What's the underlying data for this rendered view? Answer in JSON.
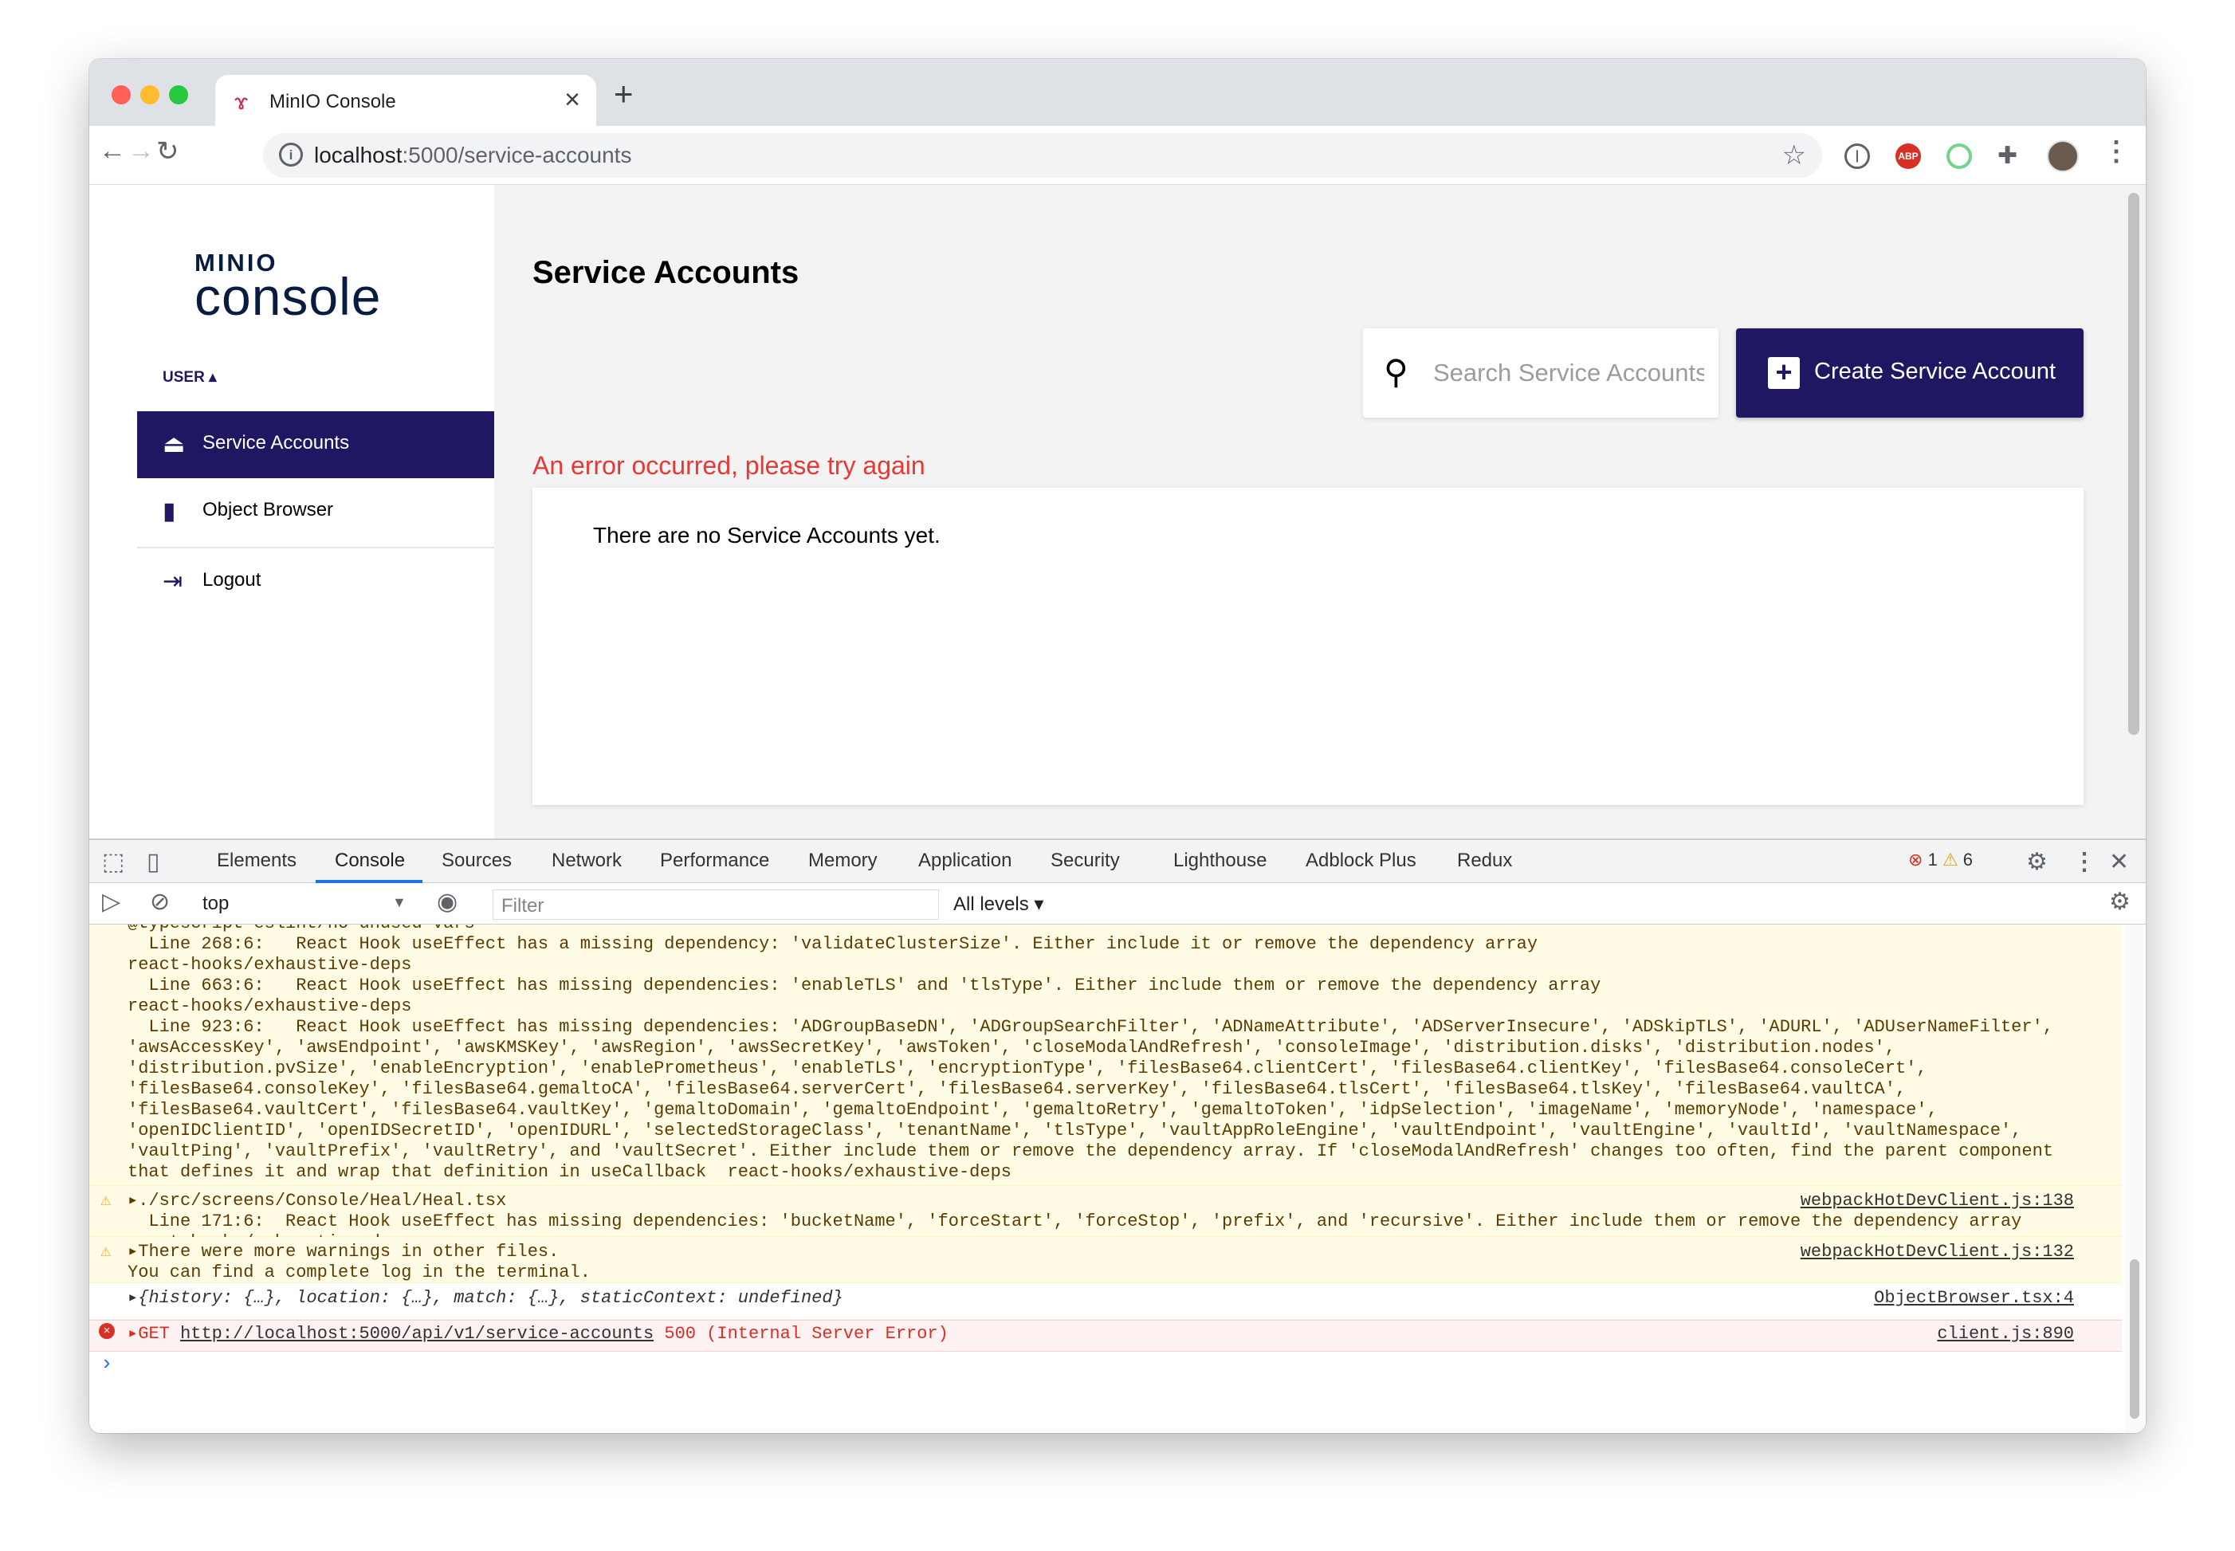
{
  "browser": {
    "tab_title": "MinIO Console",
    "url_host": "localhost",
    "url_path": ":5000/service-accounts"
  },
  "sidebar": {
    "logo_top": "MINIO",
    "logo_bottom": "console",
    "section_label": "USER ▴",
    "items": [
      {
        "label": "Service Accounts",
        "icon": "bell-icon",
        "active": true
      },
      {
        "label": "Object Browser",
        "icon": "document-icon",
        "active": false
      },
      {
        "label": "Logout",
        "icon": "logout-icon",
        "active": false
      }
    ]
  },
  "main": {
    "title": "Service Accounts",
    "search_placeholder": "Search Service Accounts",
    "create_button": "Create Service Account",
    "error_message": "An error occurred, please try again",
    "empty_message": "There are no Service Accounts yet."
  },
  "devtools": {
    "tabs": [
      "Elements",
      "Console",
      "Sources",
      "Network",
      "Performance",
      "Memory",
      "Application",
      "Security",
      "Lighthouse",
      "Adblock Plus",
      "Redux"
    ],
    "active_tab": "Console",
    "error_count": "1",
    "warning_count": "6",
    "context": "top",
    "filter_placeholder": "Filter",
    "levels": "All levels ▾",
    "console": {
      "block1": "@typescript-eslint/no-unused-vars\n  Line 268:6:   React Hook useEffect has a missing dependency: 'validateClusterSize'. Either include it or remove the dependency array\nreact-hooks/exhaustive-deps\n  Line 663:6:   React Hook useEffect has missing dependencies: 'enableTLS' and 'tlsType'. Either include them or remove the dependency array\nreact-hooks/exhaustive-deps\n  Line 923:6:   React Hook useEffect has missing dependencies: 'ADGroupBaseDN', 'ADGroupSearchFilter', 'ADNameAttribute', 'ADServerInsecure', 'ADSkipTLS', 'ADURL', 'ADUserNameFilter',\n'awsAccessKey', 'awsEndpoint', 'awsKMSKey', 'awsRegion', 'awsSecretKey', 'awsToken', 'closeModalAndRefresh', 'consoleImage', 'distribution.disks', 'distribution.nodes',\n'distribution.pvSize', 'enableEncryption', 'enablePrometheus', 'enableTLS', 'encryptionType', 'filesBase64.clientCert', 'filesBase64.clientKey', 'filesBase64.consoleCert',\n'filesBase64.consoleKey', 'filesBase64.gemaltoCA', 'filesBase64.serverCert', 'filesBase64.serverKey', 'filesBase64.tlsCert', 'filesBase64.tlsKey', 'filesBase64.vaultCA',\n'filesBase64.vaultCert', 'filesBase64.vaultKey', 'gemaltoDomain', 'gemaltoEndpoint', 'gemaltoRetry', 'gemaltoToken', 'idpSelection', 'imageName', 'memoryNode', 'namespace',\n'openIDClientID', 'openIDSecretID', 'openIDURL', 'selectedStorageClass', 'tenantName', 'tlsType', 'vaultAppRoleEngine', 'vaultEndpoint', 'vaultEngine', 'vaultId', 'vaultNamespace',\n'vaultPing', 'vaultPrefix', 'vaultRetry', and 'vaultSecret'. Either include them or remove the dependency array. If 'closeModalAndRefresh' changes too often, find the parent component\nthat defines it and wrap that definition in useCallback  react-hooks/exhaustive-deps",
      "block2": "▸./src/screens/Console/Heal/Heal.tsx\n  Line 171:6:  React Hook useEffect has missing dependencies: 'bucketName', 'forceStart', 'forceStop', 'prefix', and 'recursive'. Either include them or remove the dependency array\nreact-hooks/exhaustive-deps",
      "block2_src": "webpackHotDevClient.js:138",
      "block3": "▸There were more warnings in other files.\nYou can find a complete log in the terminal.",
      "block3_src": "webpackHotDevClient.js:132",
      "log_row": "▸{history: {…}, location: {…}, match: {…}, staticContext: undefined}",
      "log_src": "ObjectBrowser.tsx:4",
      "err_prefix": "▸GET ",
      "err_url": "http://localhost:5000/api/v1/service-accounts",
      "err_suffix": " 500 (Internal Server Error)",
      "err_src": "client.js:890",
      "prompt": "›"
    }
  }
}
